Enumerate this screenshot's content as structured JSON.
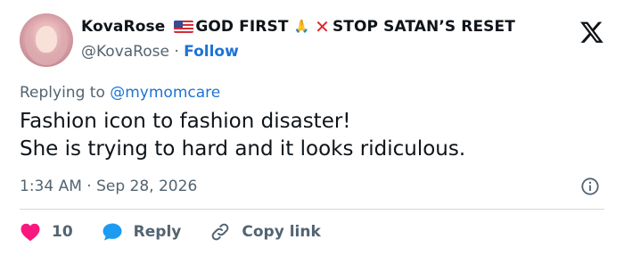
{
  "author": {
    "name": "KovaRose",
    "bio_text_1": "GOD FIRST",
    "bio_text_2": "STOP SATAN’S RESET",
    "handle": "@KovaRose",
    "separator": "·",
    "follow_label": "Follow"
  },
  "reply": {
    "prefix": "Replying to",
    "mention": "@mymomcare"
  },
  "tweet": {
    "line1": "Fashion icon to fashion disaster!",
    "line2": "She is trying to hard and it looks ridiculous."
  },
  "meta": {
    "time": "1:34 AM",
    "separator": "·",
    "date": "Sep 28, 2026"
  },
  "actions": {
    "like_count": "10",
    "reply_label": "Reply",
    "copy_label": "Copy link"
  },
  "icons": [
    "us-flag-icon",
    "praying-hands-icon",
    "red-x-icon",
    "x-logo-icon",
    "info-icon",
    "heart-icon",
    "reply-bubble-icon",
    "link-icon"
  ],
  "colors": {
    "link_blue": "#1d73d6",
    "heart_red": "#f91880",
    "secondary_text": "#536471"
  }
}
